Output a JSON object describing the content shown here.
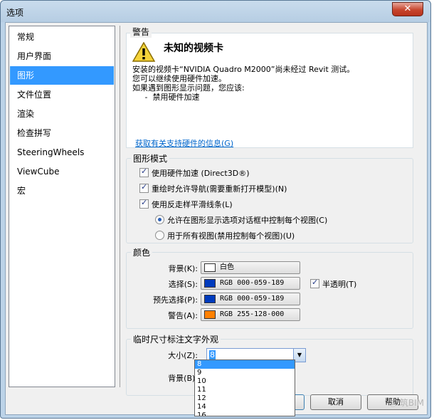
{
  "window": {
    "title": "选项",
    "close_label": "✕"
  },
  "nav": {
    "items": [
      {
        "label": "常规",
        "selected": false
      },
      {
        "label": "用户界面",
        "selected": false
      },
      {
        "label": "图形",
        "selected": true
      },
      {
        "label": "文件位置",
        "selected": false
      },
      {
        "label": "渲染",
        "selected": false
      },
      {
        "label": "检查拼写",
        "selected": false
      },
      {
        "label": "SteeringWheels",
        "selected": false
      },
      {
        "label": "ViewCube",
        "selected": false
      },
      {
        "label": "宏",
        "selected": false
      }
    ]
  },
  "warning": {
    "group_title": "警告",
    "heading": "未知的视频卡",
    "lines": [
      "安装的视频卡“NVIDIA Quadro M2000”尚未经过 Revit 测试。",
      "您可以继续使用硬件加速。",
      "如果遇到图形显示问题，您应该:",
      "     -  禁用硬件加速"
    ],
    "link": "获取有关支持硬件的信息(G)"
  },
  "graphics_mode": {
    "group_title": "图形模式",
    "options": [
      {
        "label": "使用硬件加速 (Direct3D®)",
        "checked": true
      },
      {
        "label": "重绘时允许导航(需要重新打开模型)(N)",
        "checked": true
      },
      {
        "label": "使用反走样平滑线条(L)",
        "checked": true
      }
    ],
    "radios": [
      {
        "label": "允许在图形显示选项对话框中控制每个视图(C)",
        "checked": true
      },
      {
        "label": "用于所有视图(禁用控制每个视图)(U)",
        "checked": false
      }
    ]
  },
  "colors": {
    "group_title": "颜色",
    "rows": [
      {
        "label": "背景(K):",
        "value": "白色",
        "swatch": "#ffffff"
      },
      {
        "label": "选择(S):",
        "value": "RGB 000-059-189",
        "swatch": "#003bbd"
      },
      {
        "label": "预先选择(P):",
        "value": "RGB 000-059-189",
        "swatch": "#003bbd"
      },
      {
        "label": "警告(A):",
        "value": "RGB 255-128-000",
        "swatch": "#ff8000"
      }
    ],
    "semi_transparent": {
      "label": "半透明(T)",
      "checked": true
    }
  },
  "temp_dim": {
    "group_title": "临时尺寸标注文字外观",
    "size_label": "大小(Z):",
    "size_value": "8",
    "background_label": "背景(B):",
    "dropdown_options": [
      "8",
      "9",
      "10",
      "11",
      "12",
      "14",
      "16"
    ]
  },
  "buttons": {
    "ok": "确定",
    "cancel": "取消",
    "help": "帮助"
  },
  "watermark": "Ⓢ 筑BIM"
}
